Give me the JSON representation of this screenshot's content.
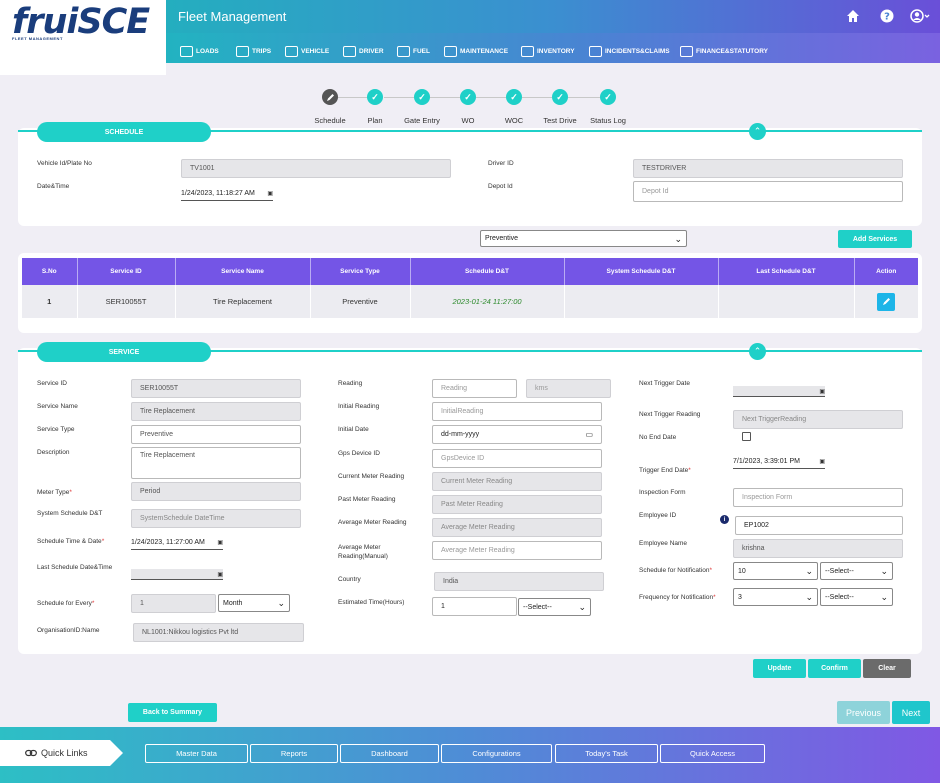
{
  "app": {
    "logo": "fruiSCE",
    "logo_sub": "FLEET MANAGEMENT",
    "title": "Fleet Management",
    "icons": [
      "home-icon",
      "help-icon",
      "user-icon"
    ]
  },
  "nav": [
    {
      "label": "LOADS"
    },
    {
      "label": "TRIPS"
    },
    {
      "label": "VEHICLE"
    },
    {
      "label": "DRIVER"
    },
    {
      "label": "FUEL"
    },
    {
      "label": "MAINTENANCE"
    },
    {
      "label": "INVENTORY"
    },
    {
      "label": "INCIDENTS&CLAIMS"
    },
    {
      "label": "FINANCE&STATUTORY"
    }
  ],
  "stepper": [
    {
      "label": "Schedule",
      "state": "current"
    },
    {
      "label": "Plan",
      "state": "done"
    },
    {
      "label": "Gate Entry",
      "state": "done"
    },
    {
      "label": "WO",
      "state": "done"
    },
    {
      "label": "WOC",
      "state": "done"
    },
    {
      "label": "Test Drive",
      "state": "done"
    },
    {
      "label": "Status Log",
      "state": "done"
    }
  ],
  "schedule": {
    "title": "SCHEDULE",
    "vehicle_label": "Vehicle Id/Plate No",
    "vehicle_value": "TV1001",
    "datetime_label": "Date&Time",
    "datetime_value": "1/24/2023, 11:18:27 AM",
    "driver_label": "Driver ID",
    "driver_value": "TESTDRIVER",
    "depot_label": "Depot Id",
    "depot_placeholder": "Depot Id",
    "type_select": "Preventive",
    "add_label": "Add Services"
  },
  "table": {
    "headers": [
      "S.No",
      "Service ID",
      "Service Name",
      "Service Type",
      "Schedule D&T",
      "System Schedule D&T",
      "Last Schedule D&T",
      "Action"
    ],
    "rows": [
      [
        "1",
        "SER10055T",
        "Tire Replacement",
        "Preventive",
        "2023-01-24 11:27:00",
        "",
        ""
      ]
    ]
  },
  "service": {
    "title": "SERVICE",
    "service_id_label": "Service ID",
    "service_id": "SER10055T",
    "service_name_label": "Service Name",
    "service_name": "Tire Replacement",
    "service_type_label": "Service Type",
    "service_type": "Preventive",
    "description_label": "Description",
    "description": "Tire Replacement",
    "meter_type_label": "Meter Type",
    "meter_type": "Period",
    "sys_sched_label": "System Schedule D&T",
    "sys_sched_placeholder": "SystemSchedule DateTime",
    "sched_time_label": "Schedule Time & Date",
    "sched_time": "1/24/2023, 11:27:00 AM",
    "last_sched_label": "Last Schedule Date&Time",
    "sched_every_label": "Schedule for Every",
    "sched_every": "1",
    "sched_every_unit": "Month",
    "org_label": "OrganisationID:Name",
    "org": "NL1001:Nikkou logistics Pvt ltd",
    "reading_label": "Reading",
    "reading_placeholder": "Reading",
    "reading_unit": "kms",
    "initial_reading_label": "Initial Reading",
    "initial_reading_placeholder": "InitialReading",
    "initial_date_label": "Initial Date",
    "initial_date": "dd-mm-yyyy",
    "gps_label": "Gps Device ID",
    "gps_placeholder": "GpsDevice ID",
    "current_meter_label": "Current Meter Reading",
    "current_meter_placeholder": "Current Meter Reading",
    "past_meter_label": "Past Meter Reading",
    "past_meter_placeholder": "Past Meter Reading",
    "avg_meter_label": "Average Meter Reading",
    "avg_meter_placeholder": "Average Meter Reading",
    "avg_manual_label_1": "Average Meter",
    "avg_manual_label_2": "Reading(Manual)",
    "avg_manual_placeholder": "Average Meter Reading",
    "country_label": "Country",
    "country": "India",
    "est_time_label": "Estimated Time(Hours)",
    "est_time": "1",
    "est_time_select": "--Select--",
    "next_trigger_date_label": "Next Trigger Date",
    "next_trigger_reading_label": "Next Trigger Reading",
    "next_trigger_reading_placeholder": "Next TriggerReading",
    "no_end_date_label": "No End Date",
    "trigger_end_label": "Trigger End Date",
    "trigger_end": "7/1/2023, 3:39:01 PM",
    "inspection_label": "Inspection Form",
    "inspection_placeholder": "Inspection Form",
    "employee_id_label": "Employee ID",
    "employee_id": "EP1002",
    "employee_name_label": "Employee Name",
    "employee_name": "krishna",
    "notif_sched_label": "Schedule for Notification",
    "notif_sched": "10",
    "notif_sched_select": "--Select--",
    "notif_freq_label": "Frequency for Notification",
    "notif_freq": "3",
    "notif_freq_select": "--Select--",
    "update": "Update",
    "confirm": "Confirm",
    "clear": "Clear"
  },
  "nav_buttons": {
    "back": "Back to Summary",
    "previous": "Previous",
    "next": "Next"
  },
  "footer": {
    "quick_links": "Quick Links",
    "links": [
      "Master Data",
      "Reports",
      "Dashboard",
      "Configurations",
      "Today's Task",
      "Quick Access"
    ]
  },
  "colors": {
    "teal": "#1fd0c8",
    "purple": "#7455e6",
    "header_gradient_start": "#24aebf",
    "header_gradient_end": "#6a4fd8"
  }
}
